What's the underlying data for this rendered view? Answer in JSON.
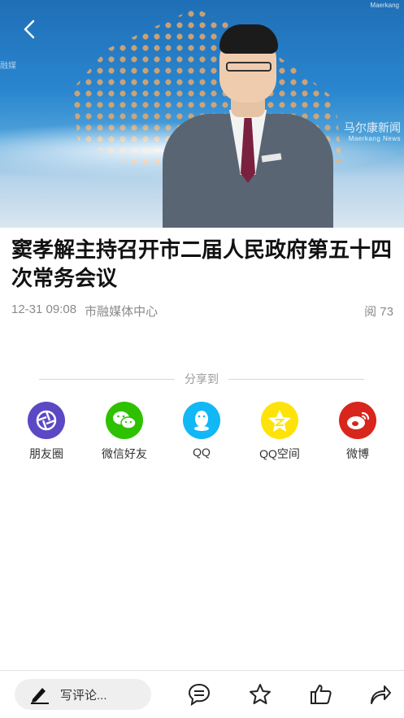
{
  "video": {
    "brand_name": "马尔康新闻",
    "brand_sub": "Maerkang News",
    "brand_top": "Maerkang",
    "left_logo": "融媒"
  },
  "article": {
    "title": "窦孝解主持召开市二届人民政府第五十四次常务会议",
    "time": "12-31 09:08",
    "source": "市融媒体中心",
    "reads": "阅 73"
  },
  "share": {
    "heading": "分享到",
    "items": [
      {
        "label": "朋友圈",
        "icon": "moments-icon",
        "color": "#5b48c4"
      },
      {
        "label": "微信好友",
        "icon": "wechat-icon",
        "color": "#2dc100"
      },
      {
        "label": "QQ",
        "icon": "qq-icon",
        "color": "#12b7f5"
      },
      {
        "label": "QQ空间",
        "icon": "qzone-icon",
        "color": "#fde30a"
      },
      {
        "label": "微博",
        "icon": "weibo-icon",
        "color": "#d9261c"
      }
    ]
  },
  "bottom_bar": {
    "comment_placeholder": "写评论...",
    "icons": [
      "comment-icon",
      "star-icon",
      "like-icon",
      "share-icon"
    ]
  }
}
